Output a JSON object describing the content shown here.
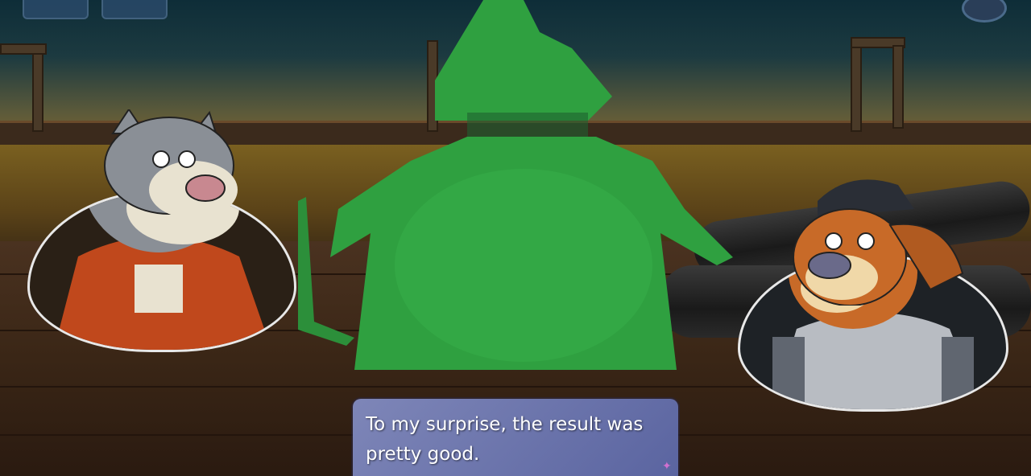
{
  "dialog": {
    "text": "To my surprise, the result was pretty good."
  },
  "hud": {
    "left_buttons": [
      "menu-icon",
      "play-icon"
    ],
    "right_button": "gear-icon"
  },
  "characters": {
    "left": "gray-rat-in-orange-hoodie",
    "right": "brown-dog-in-cap",
    "center": "green-painted-statue"
  },
  "colors": {
    "statue": "#2fa040",
    "dialog_bg": "#6a72ad",
    "portrait_border": "#e8e8e8"
  }
}
